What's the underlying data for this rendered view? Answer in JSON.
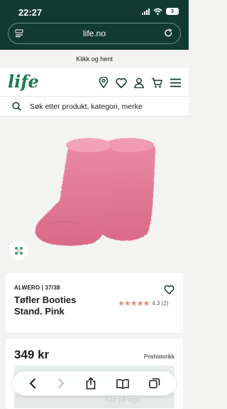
{
  "status_bar": {
    "time": "22:27",
    "battery": "3"
  },
  "browser": {
    "host": "life.no"
  },
  "promo": {
    "text": "Klikk og hent"
  },
  "header": {
    "logo": "life"
  },
  "search": {
    "placeholder": "Søk etter produkt, kategori, merke"
  },
  "product": {
    "brand_size": "ALWERO | 37/38",
    "title": "Tøfler Booties Stand. Pink",
    "rating_value": 4.3,
    "rating_text": "4.3 (2)",
    "price": "349 kr",
    "price_history": "Prishistorikk",
    "add_to_cart": "Ikke på lager"
  },
  "colors": {
    "brand_green": "#123a30",
    "logo_green": "#1e7a4a",
    "star": "#d98a83",
    "slipper": "#e07a96"
  }
}
